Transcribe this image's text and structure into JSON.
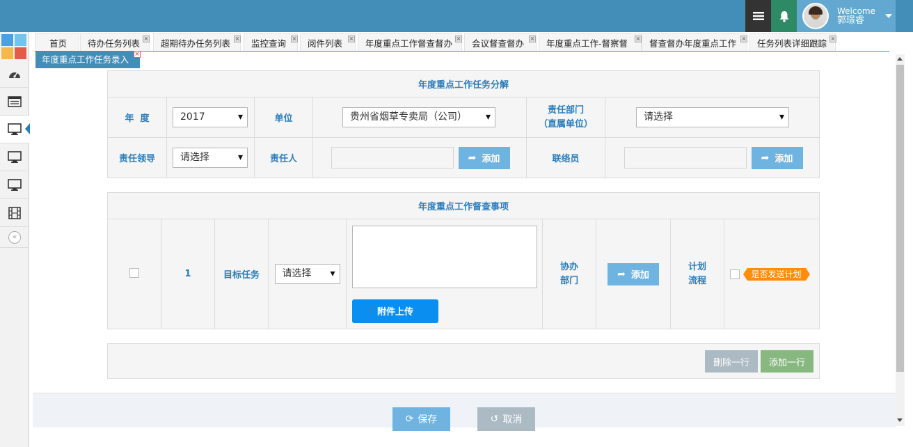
{
  "header": {
    "welcome": "Welcome",
    "username": "郭璟睿",
    "colors": {
      "bar": "#438eb9",
      "menu_btn": "#333333",
      "bell_btn": "#2e8965",
      "user_box": "#62a8d1"
    },
    "icons": [
      "menu-icon",
      "bell-icon",
      "avatar",
      "caret-down-icon"
    ]
  },
  "sidebar": {
    "logo_colors": [
      "#4aa0e0",
      "#6ec5f0",
      "#f5b84a",
      "#e25c4a"
    ],
    "items": [
      {
        "icon": "dashboard-icon",
        "active": false
      },
      {
        "icon": "list-icon",
        "active": false
      },
      {
        "icon": "desktop-icon",
        "active": true
      },
      {
        "icon": "desktop-icon",
        "active": false
      },
      {
        "icon": "desktop-icon",
        "active": false
      },
      {
        "icon": "film-icon",
        "active": false
      }
    ],
    "collapse_icon": "«"
  },
  "tabs": {
    "items": [
      {
        "label": "首页",
        "closable": false
      },
      {
        "label": "待办任务列表",
        "closable": true
      },
      {
        "label": "超期待办任务列表",
        "closable": true
      },
      {
        "label": "监控查询",
        "closable": true
      },
      {
        "label": "阅件列表",
        "closable": true
      },
      {
        "label": "年度重点工作督查督办",
        "closable": true
      },
      {
        "label": "会议督查督办",
        "closable": true
      },
      {
        "label": "年度重点工作-督察督",
        "closable": true
      },
      {
        "label": "督查督办年度重点工作",
        "closable": true
      },
      {
        "label": "任务列表详细跟踪",
        "closable": true
      }
    ],
    "active": {
      "label": "年度重点工作任务录入",
      "close": "×"
    }
  },
  "decomp": {
    "title": "年度重点工作任务分解",
    "year_label": "年  度",
    "year_value": "2017",
    "unit_label": "单位",
    "unit_value": "贵州省烟草专卖局（公司）",
    "dept_label_1": "责任部门",
    "dept_label_2": "（直属单位）",
    "dept_value": "请选择",
    "leader_label": "责任领导",
    "leader_value": "请选择",
    "person_label": "责任人",
    "person_add": "添加",
    "liaison_label": "联络员",
    "liaison_add": "添加"
  },
  "supervision": {
    "title": "年度重点工作督查事项",
    "row_no": "1",
    "target_label": "目标任务",
    "target_value": "请选择",
    "upload_label": "附件上传",
    "assist_label_1": "协办",
    "assist_label_2": "部门",
    "assist_add": "添加",
    "plan_label_1": "计划",
    "plan_label_2": "流程",
    "send_plan_badge": "是否发送计划"
  },
  "actions": {
    "delete_row": "删除一行",
    "add_row": "添加一行",
    "save": "保存",
    "cancel": "取消"
  }
}
